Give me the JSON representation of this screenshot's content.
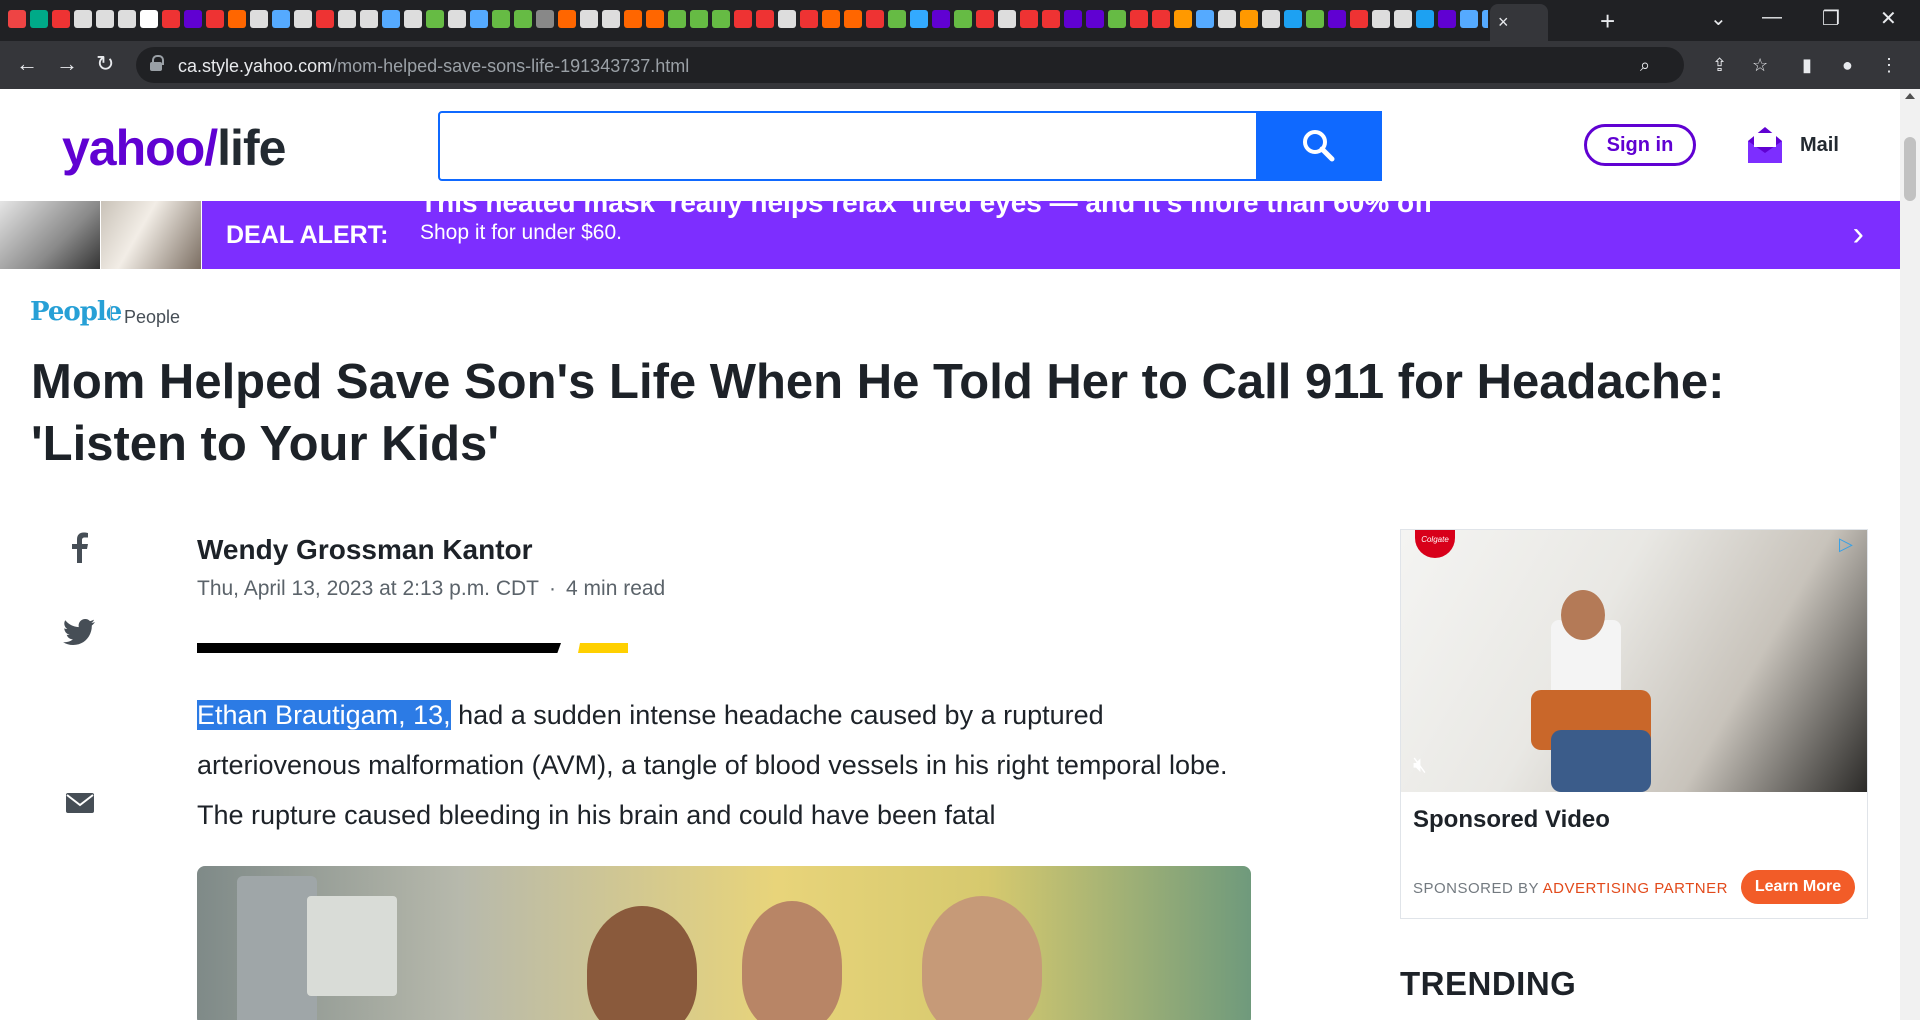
{
  "browser": {
    "tab_favicon_colors": [
      "#e44",
      "#0a8",
      "#e33",
      "#ddd",
      "#ddd",
      "#ddd",
      "#fff",
      "#e33",
      "#6001d2",
      "#e33",
      "#f60",
      "#ddd",
      "#5af",
      "#ddd",
      "#e33",
      "#ddd",
      "#ddd",
      "#5af",
      "#ddd",
      "#6b4",
      "#ddd",
      "#5af",
      "#6b4",
      "#6b4",
      "#888",
      "#f60",
      "#ddd",
      "#ddd",
      "#f60",
      "#f60",
      "#6b4",
      "#6b4",
      "#6b4",
      "#e33",
      "#e33",
      "#ddd",
      "#e33",
      "#f60",
      "#f60",
      "#e33",
      "#6b4",
      "#3af",
      "#6001d2",
      "#6b4",
      "#e33",
      "#ddd",
      "#e33",
      "#e33",
      "#6001d2",
      "#6001d2",
      "#6b4",
      "#e33",
      "#e33",
      "#f90",
      "#5af",
      "#ddd",
      "#f90",
      "#ddd",
      "#1da1f2",
      "#6b4",
      "#6001d2",
      "#e33",
      "#ddd",
      "#ddd",
      "#1da1f2",
      "#6001d2",
      "#5af",
      "#5af",
      "#6b4",
      "#6b4",
      "#ddd",
      "#5af"
    ],
    "active_tab_close": "×",
    "new_tab": "+",
    "window_controls": [
      "⌄",
      "—",
      "❐",
      "✕"
    ],
    "url_host": "ca.style.yahoo.com",
    "url_path": "/mom-helped-save-sons-life-191343737.html"
  },
  "header": {
    "logo_main": "yahoo",
    "logo_slash": "/",
    "logo_section": "life",
    "search_placeholder": "",
    "sign_in_label": "Sign in",
    "mail_label": "Mail",
    "brand_color": "#6001d2"
  },
  "deal_banner": {
    "label": "DEAL ALERT:",
    "headline": "This heated mask 'really helps relax' tired eyes — and it's more than 60% off",
    "subline": "Shop it for under $60.",
    "arrow": "›"
  },
  "article": {
    "source_logo": "People",
    "source_name": "People",
    "title": "Mom Helped Save Son's Life When He Told Her to Call 911 for Headache: 'Listen to Your Kids'",
    "author": "Wendy Grossman Kantor",
    "date": "Thu, April 13, 2023 at 2:13 p.m. CDT",
    "meta_sep": "·",
    "read_time": "4 min read",
    "lead_highlight": "Ethan Brautigam, 13,",
    "lead_rest": " had a sudden intense headache caused by a ruptured arteriovenous malformation (AVM), a tangle of blood vessels in his right temporal lobe. The rupture caused bleeding in his brain and could have been fatal"
  },
  "share_icons": [
    "facebook-icon",
    "twitter-icon",
    "email-icon"
  ],
  "ad": {
    "brand_badge": "Colgate",
    "title": "Sponsored Video",
    "sponsored_by": "SPONSORED BY",
    "partner": "ADVERTISING PARTNER",
    "cta": "Learn More"
  },
  "sidebar": {
    "trending_heading": "TRENDING"
  }
}
